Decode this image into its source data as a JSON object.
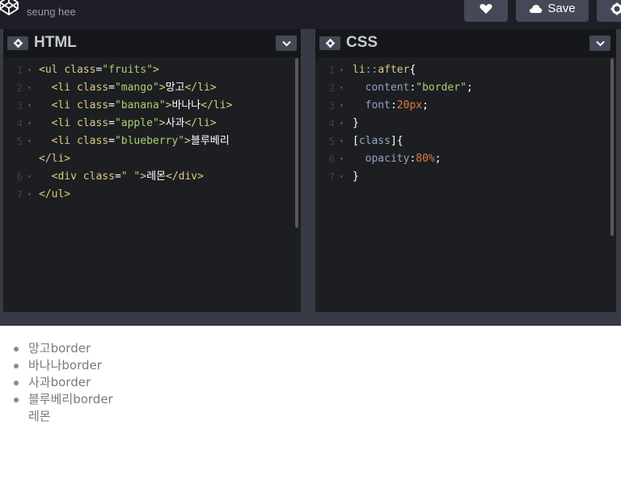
{
  "header": {
    "author": "seung hee",
    "save_label": "Save",
    "icons": {
      "logo": "codepen-cube-icon",
      "heart": "heart-icon",
      "save": "cloud-icon",
      "settings": "gear-icon"
    }
  },
  "html_panel": {
    "title": "HTML",
    "lines": [
      {
        "n": "1",
        "parts": [
          [
            "tag",
            "<ul "
          ],
          [
            "attr",
            "class"
          ],
          [
            "eq",
            "="
          ],
          [
            "str",
            "\"fruits\""
          ],
          [
            "tag",
            ">"
          ]
        ]
      },
      {
        "n": "2",
        "parts": [
          [
            "plain",
            "  "
          ],
          [
            "tag",
            "<li "
          ],
          [
            "attr",
            "class"
          ],
          [
            "eq",
            "="
          ],
          [
            "str",
            "\"mango\""
          ],
          [
            "tag",
            ">"
          ],
          [
            "plain",
            "망고"
          ],
          [
            "tag",
            "</li>"
          ]
        ]
      },
      {
        "n": "3",
        "parts": [
          [
            "plain",
            "  "
          ],
          [
            "tag",
            "<li "
          ],
          [
            "attr",
            "class"
          ],
          [
            "eq",
            "="
          ],
          [
            "str",
            "\"banana\""
          ],
          [
            "tag",
            ">"
          ],
          [
            "plain",
            "바나나"
          ],
          [
            "tag",
            "</li>"
          ]
        ]
      },
      {
        "n": "4",
        "parts": [
          [
            "plain",
            "  "
          ],
          [
            "tag",
            "<li "
          ],
          [
            "attr",
            "class"
          ],
          [
            "eq",
            "="
          ],
          [
            "str",
            "\"apple\""
          ],
          [
            "tag",
            ">"
          ],
          [
            "plain",
            "사과"
          ],
          [
            "tag",
            "</li>"
          ]
        ]
      },
      {
        "n": "5",
        "parts": [
          [
            "plain",
            "  "
          ],
          [
            "tag",
            "<li "
          ],
          [
            "attr",
            "class"
          ],
          [
            "eq",
            "="
          ],
          [
            "str",
            "\"blueberry\""
          ],
          [
            "tag",
            ">"
          ],
          [
            "plain",
            "블루베리"
          ]
        ]
      },
      {
        "n": "",
        "parts": [
          [
            "tag",
            "</li>"
          ]
        ]
      },
      {
        "n": "6",
        "parts": [
          [
            "plain",
            "  "
          ],
          [
            "tag",
            "<div "
          ],
          [
            "attr",
            "class"
          ],
          [
            "eq",
            "="
          ],
          [
            "str",
            "\" \""
          ],
          [
            "tag",
            ">"
          ],
          [
            "plain",
            "레몬"
          ],
          [
            "tag",
            "</div>"
          ]
        ]
      },
      {
        "n": "7",
        "parts": [
          [
            "tag",
            "</ul>"
          ]
        ]
      }
    ]
  },
  "css_panel": {
    "title": "CSS",
    "lines": [
      {
        "n": "1",
        "parts": [
          [
            "sel",
            "li"
          ],
          [
            "pseudo",
            "::"
          ],
          [
            "sel",
            "after"
          ],
          [
            "plain",
            "{"
          ]
        ]
      },
      {
        "n": "2",
        "parts": [
          [
            "plain",
            "  "
          ],
          [
            "prop",
            "content"
          ],
          [
            "plain",
            ":"
          ],
          [
            "css-str",
            "\"border\""
          ],
          [
            "plain",
            ";"
          ]
        ]
      },
      {
        "n": "3",
        "parts": [
          [
            "plain",
            "  "
          ],
          [
            "prop",
            "font"
          ],
          [
            "plain",
            ":"
          ],
          [
            "num-val",
            "20px"
          ],
          [
            "plain",
            ";"
          ]
        ]
      },
      {
        "n": "4",
        "parts": [
          [
            "plain",
            "}"
          ]
        ]
      },
      {
        "n": "5",
        "parts": [
          [
            "plain",
            "["
          ],
          [
            "pseudo",
            "class"
          ],
          [
            "plain",
            "]{"
          ]
        ]
      },
      {
        "n": "6",
        "parts": [
          [
            "plain",
            "  "
          ],
          [
            "prop",
            "opacity"
          ],
          [
            "plain",
            ":"
          ],
          [
            "num-val",
            "80%"
          ],
          [
            "plain",
            ";"
          ]
        ]
      },
      {
        "n": "7",
        "parts": [
          [
            "plain",
            "}"
          ]
        ]
      }
    ]
  },
  "result": {
    "items": [
      "망고border",
      "바나나border",
      "사과border",
      "블루베리border"
    ],
    "div_text": "레몬"
  }
}
